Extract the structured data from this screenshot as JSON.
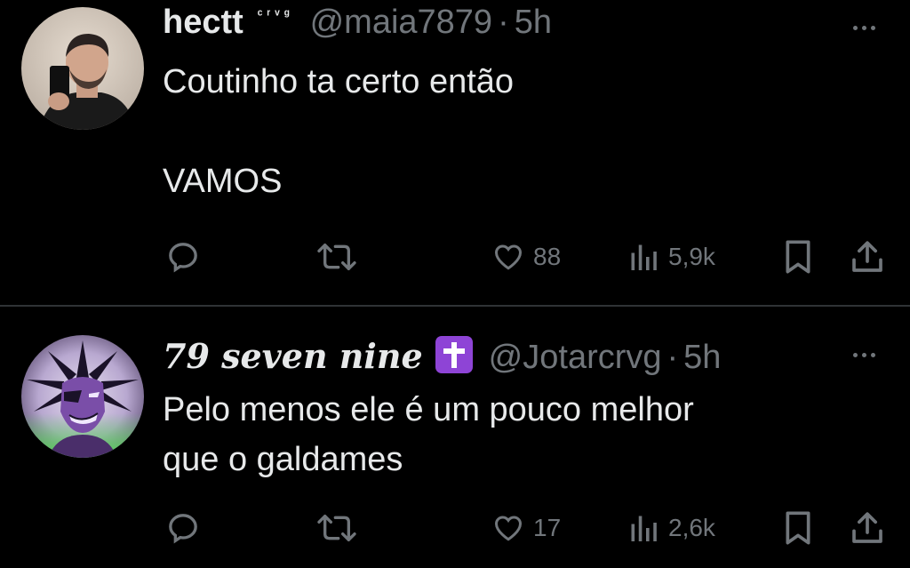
{
  "tweets": [
    {
      "display_name": "hectt",
      "name_suffix": "ᶜʳᵛᵍ",
      "handle": "@maia7879",
      "separator": "·",
      "time": "5h",
      "text": "Coutinho ta certo então\n\nVAMOS",
      "likes": "88",
      "views": "5,9k",
      "avatar_icon": "selfie-photo"
    },
    {
      "display_name": "79 seven nine",
      "name_emoji": "latin-cross-emoji",
      "handle": "@Jotarcrvg",
      "separator": "·",
      "time": "5h",
      "text": "Pelo menos ele é um pouco melhor\nque o galdames",
      "likes": "17",
      "views": "2,6k",
      "avatar_icon": "anime-character"
    }
  ],
  "icons": {
    "reply": "speech-bubble",
    "retweet": "two-arrows-loop",
    "like": "heart",
    "views": "bar-chart",
    "bookmark": "bookmark",
    "share": "arrow-up-from-tray",
    "more": "three-dots"
  },
  "colors": {
    "background": "#000000",
    "text": "#e7e9ea",
    "secondary": "#71767b",
    "divider": "#2f3336",
    "badge": "#8e44d6"
  }
}
